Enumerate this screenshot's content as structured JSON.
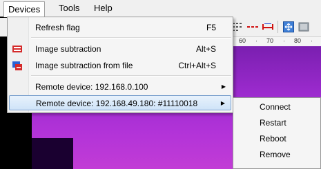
{
  "menubar": {
    "items": [
      {
        "label": "Devices"
      },
      {
        "label": "Tools"
      },
      {
        "label": "Help"
      }
    ]
  },
  "devices_menu": {
    "items": [
      {
        "label": "Refresh flag",
        "shortcut": "F5",
        "icon": "none"
      },
      {
        "label": "Image subtraction",
        "shortcut": "Alt+S",
        "icon": "image-subtraction-icon"
      },
      {
        "label": "Image subtraction from file",
        "shortcut": "Ctrl+Alt+S",
        "icon": "image-subtraction-file-icon"
      },
      {
        "label": "Remote device: 192.168.0.100",
        "shortcut": "",
        "icon": "none"
      },
      {
        "label": "Remote device: 192.168.49.180:  #11110018",
        "shortcut": "",
        "icon": "none"
      }
    ]
  },
  "submenu": {
    "items": [
      {
        "label": "Connect"
      },
      {
        "label": "Restart"
      },
      {
        "label": "Reboot"
      },
      {
        "label": "Remove"
      }
    ]
  },
  "ruler": {
    "ticks": [
      "60",
      "70",
      "80"
    ]
  },
  "colors": {
    "highlight_border": "#7da2ce",
    "thermal_purple": "#9d2bcf"
  }
}
